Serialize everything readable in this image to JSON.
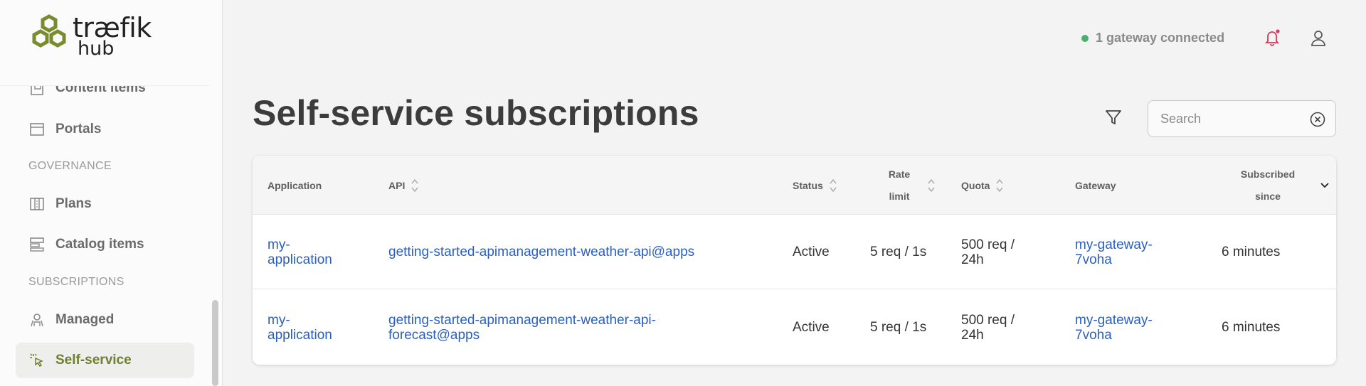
{
  "brand": {
    "name": "træfik",
    "sub": "hub"
  },
  "sidebar": {
    "items": [
      {
        "label": "Content items",
        "icon": "content-items-icon"
      },
      {
        "label": "Portals",
        "icon": "portal-icon"
      },
      {
        "label": "Plans",
        "icon": "plans-icon"
      },
      {
        "label": "Catalog items",
        "icon": "catalog-icon"
      },
      {
        "label": "Managed",
        "icon": "managed-icon"
      },
      {
        "label": "Self-service",
        "icon": "cursor-click-icon",
        "active": true
      }
    ],
    "sections": {
      "governance": "GOVERNANCE",
      "subscriptions": "SUBSCRIPTIONS"
    }
  },
  "header": {
    "gateway_status": "1 gateway connected",
    "status_color": "#4caf6e",
    "notification_color": "#e0365a"
  },
  "main": {
    "title": "Self-service subscriptions",
    "search": {
      "placeholder": "Search",
      "value": ""
    }
  },
  "table": {
    "columns": {
      "application": "Application",
      "api": "API",
      "status": "Status",
      "rate_limit_1": "Rate",
      "rate_limit_2": "limit",
      "quota": "Quota",
      "gateway": "Gateway",
      "subscribed_1": "Subscribed",
      "subscribed_2": "since"
    },
    "rows": [
      {
        "app_1": "my-",
        "app_2": "application",
        "api_1": "getting-started-apimanagement-weather-api@apps",
        "api_2": "",
        "status": "Active",
        "rate": "5 req / 1s",
        "quota_1": "500 req /",
        "quota_2": "24h",
        "gw_1": "my-gateway-",
        "gw_2": "7voha",
        "since": "6 minutes"
      },
      {
        "app_1": "my-",
        "app_2": "application",
        "api_1": "getting-started-apimanagement-weather-api-",
        "api_2": "forecast@apps",
        "status": "Active",
        "rate": "5 req / 1s",
        "quota_1": "500 req /",
        "quota_2": "24h",
        "gw_1": "my-gateway-",
        "gw_2": "7voha",
        "since": "6 minutes"
      }
    ]
  },
  "colors": {
    "accent": "#6f7f2f",
    "link": "#2a5fc0",
    "logo": "#7a8a2e"
  }
}
